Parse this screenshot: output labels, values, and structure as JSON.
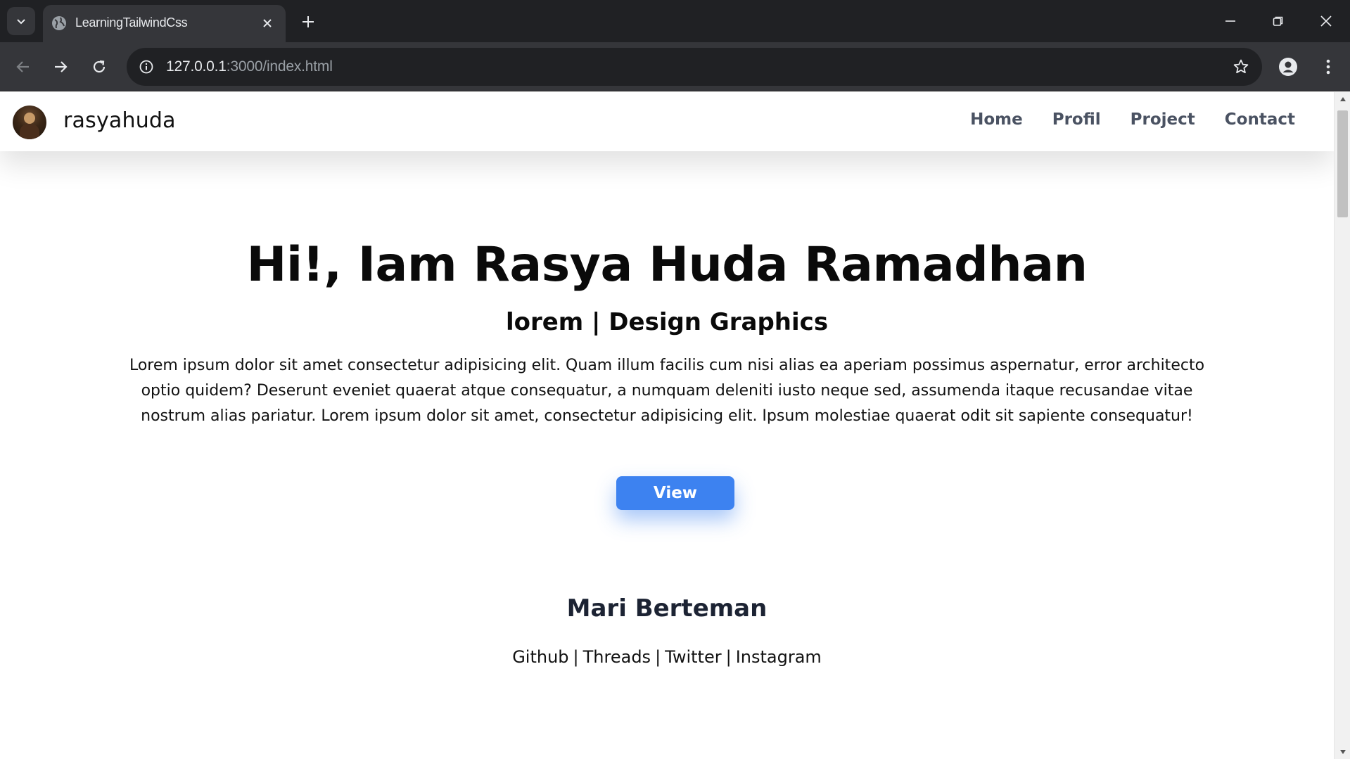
{
  "browser": {
    "tab_title": "LearningTailwindCss",
    "url_host": "127.0.0.1",
    "url_path": ":3000/index.html"
  },
  "site": {
    "brand": "rasyahuda",
    "nav": [
      "Home",
      "Profil",
      "Project",
      "Contact"
    ]
  },
  "hero": {
    "title": "Hi!, Iam Rasya Huda Ramadhan",
    "subtitle": "lorem | Design Graphics",
    "description": "Lorem ipsum dolor sit amet consectetur adipisicing elit. Quam illum facilis cum nisi alias ea aperiam possimus aspernatur, error architecto optio quidem? Deserunt eveniet quaerat atque consequatur, a numquam deleniti iusto neque sed, assumenda itaque recusandae vitae nostrum alias pariatur. Lorem ipsum dolor sit amet, consectetur adipisicing elit. Ipsum molestiae quaerat odit sit sapiente consequatur!",
    "button": "View"
  },
  "friends": {
    "title": "Mari Berteman",
    "links": [
      "Github",
      "Threads",
      "Twitter",
      "Instagram"
    ],
    "separator": "|"
  },
  "colors": {
    "accent": "#3d82f0",
    "nav_text": "#4a5262",
    "chrome_dark": "#202124",
    "chrome_toolbar": "#35363a"
  },
  "icons": [
    "tab-search-icon",
    "globe-icon",
    "close-icon",
    "plus-icon",
    "minimize-icon",
    "restore-icon",
    "window-close-icon",
    "back-icon",
    "forward-icon",
    "reload-icon",
    "site-info-icon",
    "star-icon",
    "profile-icon",
    "more-vert-icon",
    "scroll-up-icon",
    "scroll-down-icon"
  ]
}
